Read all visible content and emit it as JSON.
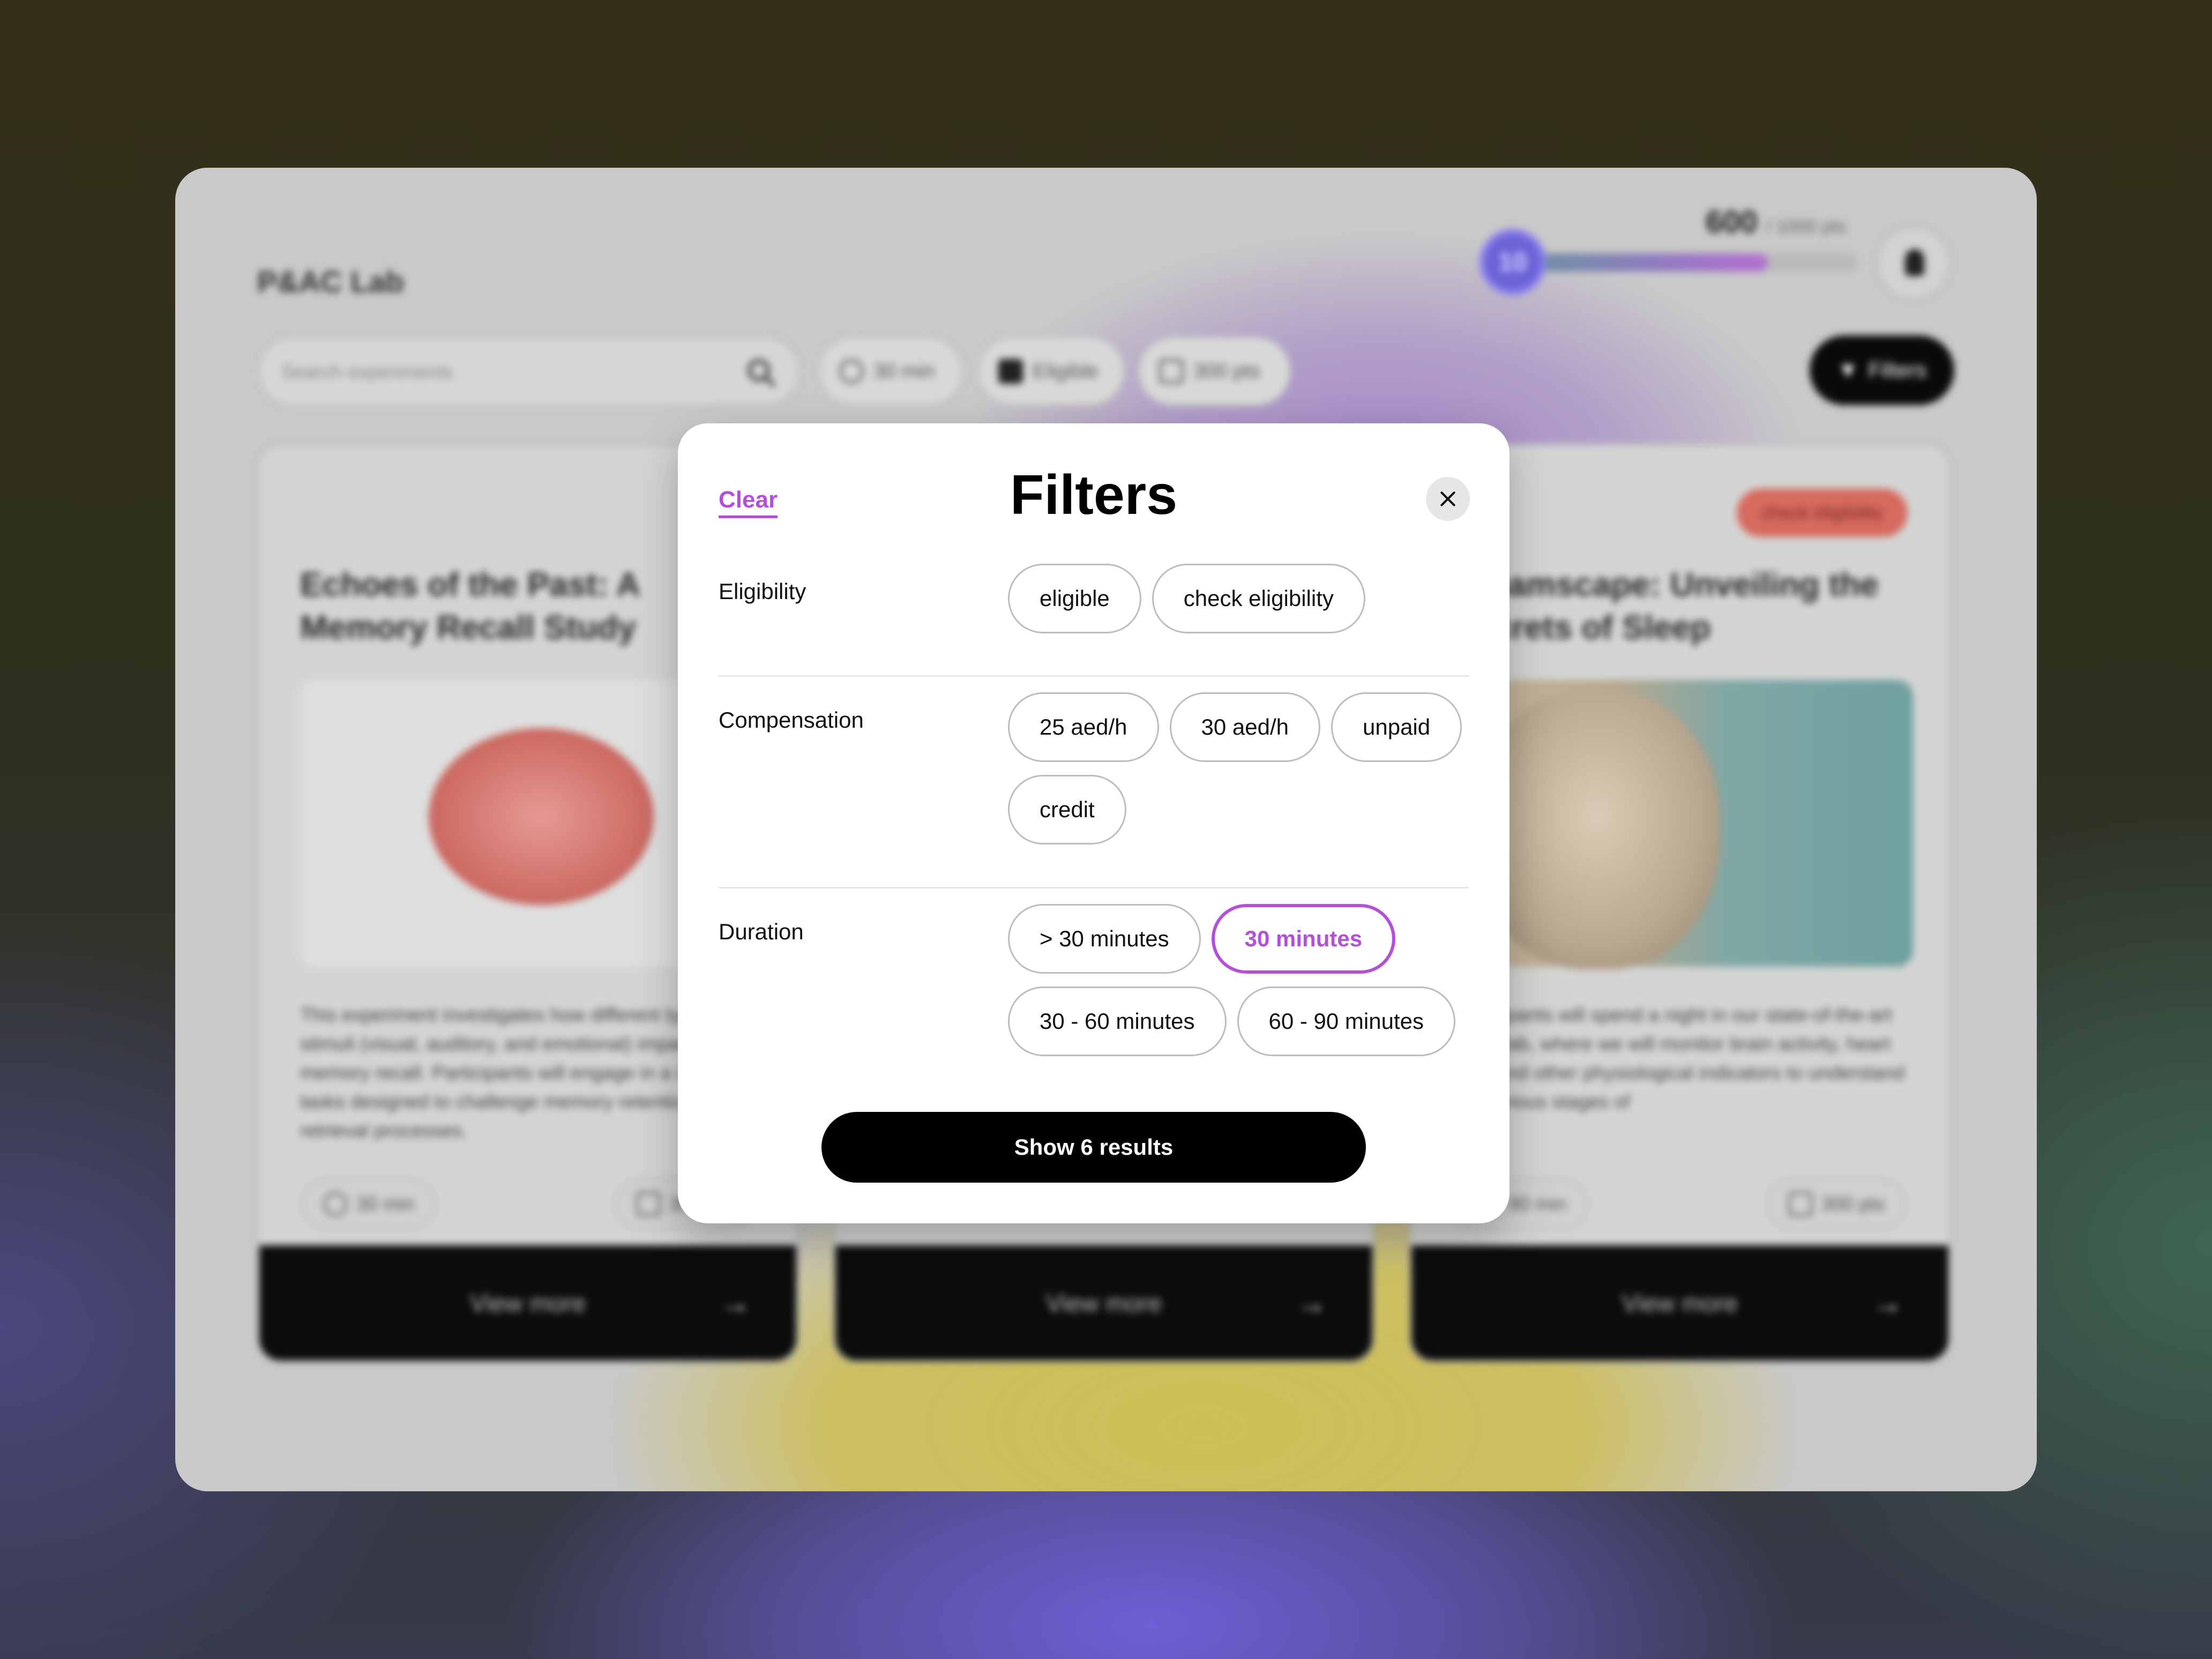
{
  "background_app": {
    "lab_name": "P&AC Lab",
    "search_placeholder": "Search experiments",
    "quick_chips": [
      "30 min",
      "Eligible",
      "300 pts"
    ],
    "filters_button": "Filters",
    "points": "600",
    "points_total": "/ 1000 pts",
    "level": "10",
    "progress_fraction": 0.72,
    "cards": [
      {
        "title": "Echoes of the Past: A Memory Recall Study",
        "description": "This experiment investigates how different types of stimuli (visual, auditory, and emotional) impact memory recall. Participants will engage in a series of tasks designed to challenge memory retention and retrieval processes.",
        "duration": "30 min",
        "points": "300 pts",
        "tag": "",
        "footer": "View more"
      },
      {
        "title": "",
        "description": "",
        "duration": "",
        "points": "",
        "tag": "",
        "footer": "View more"
      },
      {
        "title": "Dreamscape: Unveiling the Secrets of Sleep",
        "description": "Participants will spend a night in our state-of-the-art sleep lab, where we will monitor brain activity, heart rate, and other physiological indicators to understand the various stages of",
        "duration": "90 min",
        "points": "300 pts",
        "tag": "check eligibility",
        "footer": "View more"
      }
    ]
  },
  "modal": {
    "title": "Filters",
    "clear_label": "Clear",
    "close_icon": "close-icon",
    "accent_color": "#b44fd8",
    "sections": [
      {
        "label": "Eligibility",
        "options": [
          {
            "label": "eligible",
            "selected": false
          },
          {
            "label": "check eligibility",
            "selected": false
          }
        ]
      },
      {
        "label": "Compensation",
        "options": [
          {
            "label": "25 aed/h",
            "selected": false
          },
          {
            "label": "30 aed/h",
            "selected": false
          },
          {
            "label": "unpaid",
            "selected": false
          },
          {
            "label": "credit",
            "selected": false
          }
        ]
      },
      {
        "label": "Duration",
        "options": [
          {
            "label": "> 30 minutes",
            "selected": false
          },
          {
            "label": "30 minutes",
            "selected": true
          },
          {
            "label": "30 - 60 minutes",
            "selected": false
          },
          {
            "label": "60 - 90 minutes",
            "selected": false
          }
        ]
      }
    ],
    "show_results_label": "Show 6 results"
  }
}
